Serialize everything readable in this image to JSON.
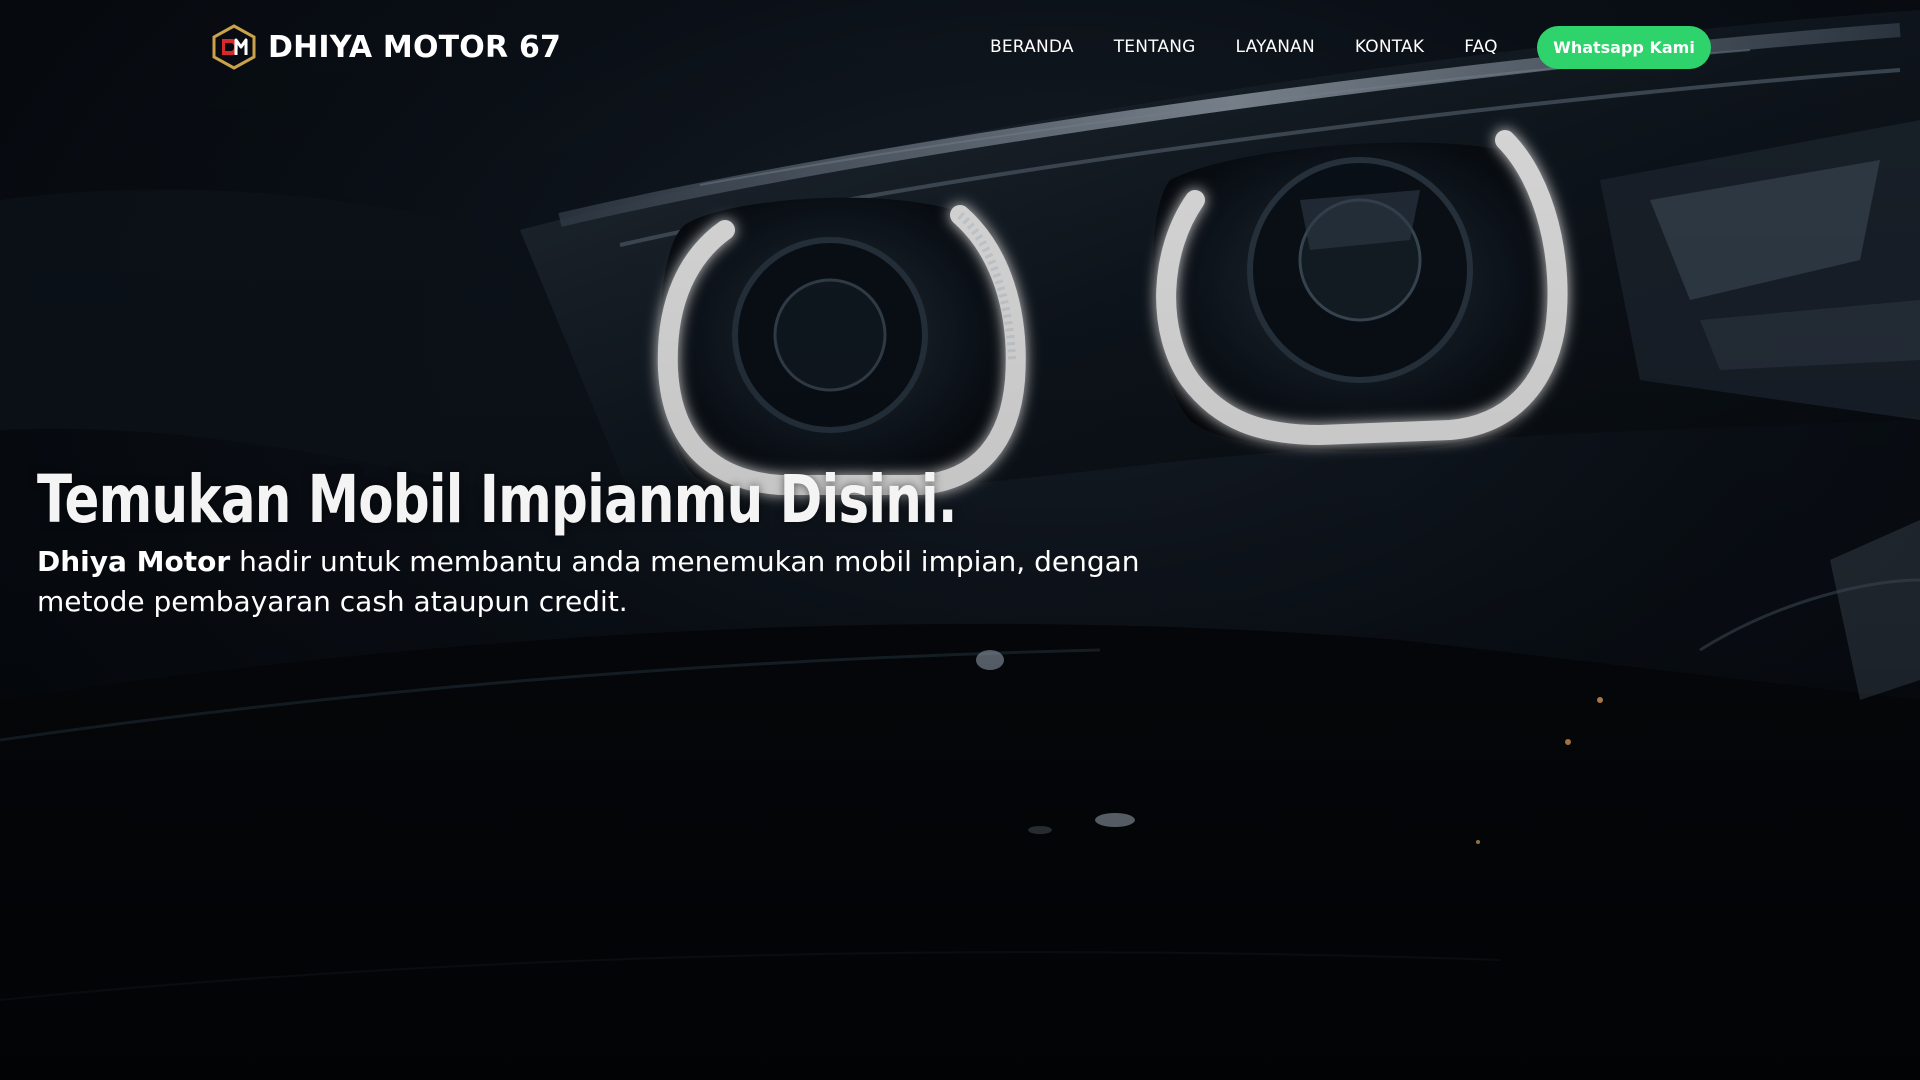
{
  "brand": {
    "name": "DHIYA MOTOR 67",
    "logo_icon": "dm-monogram-logo-icon"
  },
  "nav": {
    "items": [
      {
        "label": "BERANDA"
      },
      {
        "label": "TENTANG"
      },
      {
        "label": "LAYANAN"
      },
      {
        "label": "KONTAK"
      },
      {
        "label": "FAQ"
      }
    ],
    "cta_label": "Whatsapp Kami"
  },
  "hero": {
    "title": "Temukan Mobil Impianmu Disini.",
    "brand_highlight": "Dhiya Motor",
    "description": " hadir untuk membantu anda menemukan mobil impian, dengan metode pembayaran cash ataupun credit.",
    "background": "car-headlight-photo"
  },
  "colors": {
    "cta": "#2ed36b",
    "background": "#05080d",
    "text": "#ffffff",
    "logo_gold": "#c9a24a",
    "logo_red": "#d42a2a"
  }
}
